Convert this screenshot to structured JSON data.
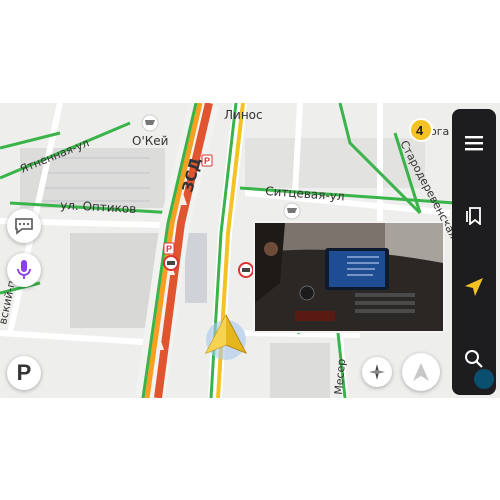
{
  "map": {
    "street_labels": {
      "linos": "Линос",
      "okey": "О'Кей",
      "yatnaya": "Ятненная-ул",
      "optikov": "ул. Оптиков",
      "zsd": "ЗСД",
      "sitcevaya": "Ситцевая-ул",
      "starodereven": "Стародеревенская",
      "evsky": "вский-пр",
      "meser": "Месер",
      "oga": "ога"
    },
    "traffic_badge": "4",
    "route_colors": {
      "highway_red": "#e0542f",
      "highway_orange": "#f5a020",
      "road_green": "#3ab44a",
      "road_yellow": "#f4c323"
    }
  },
  "left_buttons": {
    "chat": "chat-bubble-icon",
    "voice": "microphone-icon",
    "parking_label": "P"
  },
  "right_rail": {
    "items": [
      "menu-icon",
      "bookmark-icon",
      "navigation-arrow-icon",
      "search-icon"
    ],
    "active_color": "#f4c323"
  },
  "controls": {
    "compass": "compass-icon",
    "north": "north-arrow-icon"
  },
  "video": {
    "screen_title": "",
    "accent": "#2c6fd6"
  }
}
